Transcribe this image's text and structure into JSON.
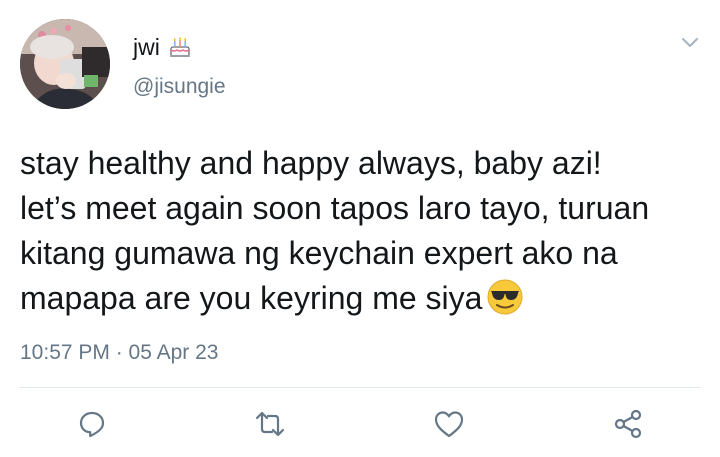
{
  "user": {
    "display_name": "jwi",
    "display_name_emoji": "birthday-cake-emoji",
    "handle": "@jisungie"
  },
  "tweet": {
    "text_lines": [
      "stay healthy and happy always, baby azi!",
      "let’s meet again soon tapos laro tayo, turuan",
      "kitang gumawa ng keychain expert ako na",
      "mapapa are you keyring me siya"
    ],
    "trailing_emoji": "sunglasses-face-emoji",
    "timestamp": "10:57 PM · 05 Apr 23"
  },
  "actions": [
    {
      "name": "reply",
      "icon": "reply-icon"
    },
    {
      "name": "retweet",
      "icon": "retweet-icon"
    },
    {
      "name": "like",
      "icon": "heart-icon"
    },
    {
      "name": "share",
      "icon": "share-icon"
    }
  ],
  "colors": {
    "text": "#14171a",
    "secondary": "#657786",
    "icon": "#657786",
    "divider": "#e1e8ed"
  }
}
